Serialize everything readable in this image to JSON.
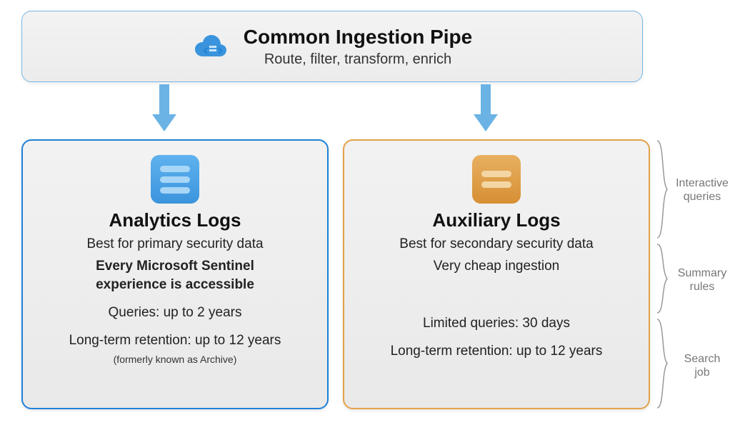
{
  "top": {
    "title": "Common Ingestion Pipe",
    "subtitle": "Route, filter, transform, enrich"
  },
  "left": {
    "title": "Analytics Logs",
    "line1": "Best for primary security data",
    "boldline_a": "Every Microsoft Sentinel",
    "boldline_b": "experience is accessible",
    "queries": "Queries: up to 2 years",
    "retention": "Long-term retention: up to 12 years",
    "retention_note": "(formerly known as Archive)"
  },
  "right": {
    "title": "Auxiliary Logs",
    "line1": "Best for secondary security data",
    "line2": "Very cheap ingestion",
    "queries": "Limited queries: 30 days",
    "retention": "Long-term retention: up to 12 years"
  },
  "side": {
    "label1a": "Interactive",
    "label1b": "queries",
    "label2a": "Summary",
    "label2b": "rules",
    "label3a": "Search",
    "label3b": "job"
  },
  "colors": {
    "arrow": "#6bb3e5",
    "blue_border": "#1f81d6",
    "orange_border": "#e2a24a"
  }
}
